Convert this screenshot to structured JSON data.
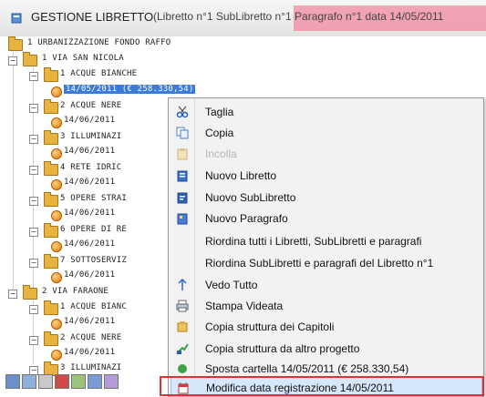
{
  "window": {
    "title": "GESTIONE LIBRETTO",
    "subtitle": "(Libretto n°1 SubLibretto n°1 Paragrafo n°1 data 14/05/2011"
  },
  "tree": {
    "root": "1  URBANIZZAZIONE FONDO RAFFO",
    "n1": "1  VIA SAN NICOLA",
    "n1_1": "1  ACQUE BIANCHE",
    "n1_1_date": "14/05/2011  (€ 258.330,54)",
    "n1_2": "2  ACQUE NERE",
    "n1_2_date": "14/06/2011",
    "n1_3": "3  ILLUMINAZI",
    "n1_3_date": "14/06/2011",
    "n1_4": "4  RETE IDRIC",
    "n1_4_date": "14/06/2011",
    "n1_5": "5  OPERE STRAI",
    "n1_5_date": "14/06/2011",
    "n1_6": "6  OPERE DI RE",
    "n1_6_date": "14/06/2011",
    "n1_7": "7  SOTTOSERVIZ",
    "n1_7_date": "14/06/2011",
    "n2": "2  VIA FARAONE",
    "n2_1": "1  ACQUE BIANC",
    "n2_1_date": "14/06/2011",
    "n2_2": "2  ACQUE NERE",
    "n2_2_date": "14/06/2011",
    "n2_3": "3  ILLUMINAZI"
  },
  "menu": {
    "items": [
      {
        "label": "Taglia",
        "icon": "scissors-icon"
      },
      {
        "label": "Copia",
        "icon": "copy-icon"
      },
      {
        "label": "Incolla",
        "icon": "paste-icon"
      },
      {
        "label": "Nuovo Libretto",
        "icon": "new-book-icon"
      },
      {
        "label": "Nuovo SubLibretto",
        "icon": "new-sub-book-icon"
      },
      {
        "label": "Nuovo Paragrafo",
        "icon": "new-paragraph-icon"
      },
      {
        "label": "Riordina tutti i Libretti, SubLibretti e paragrafi",
        "icon": ""
      },
      {
        "label": "Riordina SubLibretti e paragrafi del Libretto n°1",
        "icon": ""
      },
      {
        "label": "Vedo Tutto",
        "icon": "expand-icon"
      },
      {
        "label": "Stampa Videata",
        "icon": "print-icon"
      },
      {
        "label": "Copia struttura dei Capitoli",
        "icon": "copy-structure-icon"
      },
      {
        "label": "Copia struttura da altro progetto",
        "icon": "import-icon"
      },
      {
        "label": "Sposta cartella 14/05/2011  (€ 258.330,54)",
        "icon": "move-icon"
      },
      {
        "label": "Modifica data registrazione 14/05/2011",
        "icon": "edit-date-icon"
      }
    ]
  },
  "colors": {
    "selection": "#3a7cdc",
    "highlight_box": "#e03030",
    "menu_bg": "#f2f2f2",
    "title_band": "#f28aa0"
  }
}
